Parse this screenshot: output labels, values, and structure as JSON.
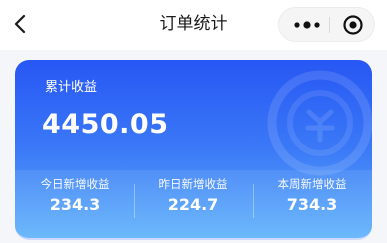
{
  "header": {
    "title": "订单统计",
    "back_icon": "chevron-left-icon",
    "more_icon": "more-dots-icon",
    "close_icon": "target-close-icon"
  },
  "summary": {
    "total_label": "累计收益",
    "total_value": "4450.05",
    "accent_gradient": [
      "#2757f4",
      "#60b3fb"
    ]
  },
  "stats": [
    {
      "label": "今日新增收益",
      "value": "234.3"
    },
    {
      "label": "昨日新增收益",
      "value": "224.7"
    },
    {
      "label": "本周新增收益",
      "value": "734.3"
    }
  ]
}
